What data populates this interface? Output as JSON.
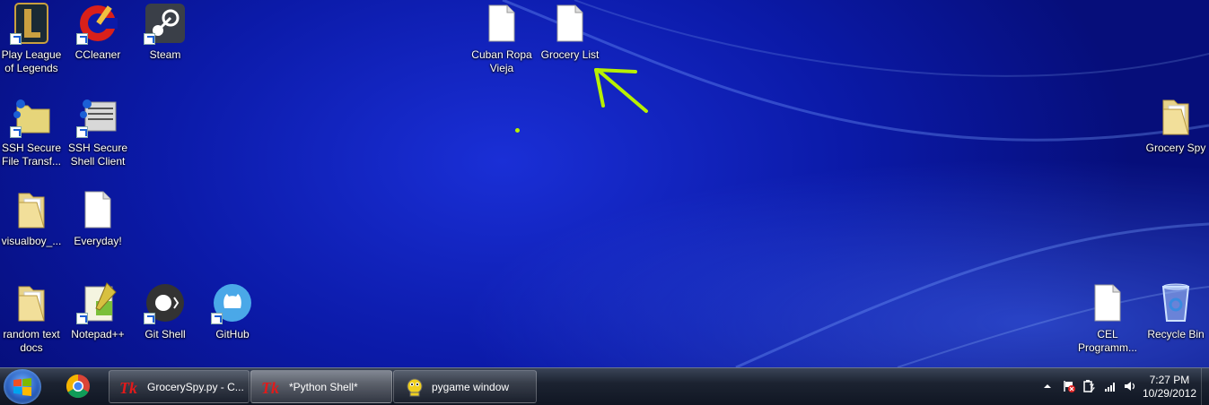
{
  "desktop": {
    "icons": [
      {
        "label": "Play League of Legends"
      },
      {
        "label": "CCleaner"
      },
      {
        "label": "Steam"
      },
      {
        "label": "SSH Secure File Transf..."
      },
      {
        "label": "SSH Secure Shell Client"
      },
      {
        "label": "visualboy_..."
      },
      {
        "label": "Everyday!"
      },
      {
        "label": "random text docs"
      },
      {
        "label": "Notepad++"
      },
      {
        "label": "Git Shell"
      },
      {
        "label": "GitHub"
      },
      {
        "label": "Cuban Ropa Vieja"
      },
      {
        "label": "Grocery List"
      },
      {
        "label": "Grocery Spy"
      },
      {
        "label": "CEL Programm..."
      },
      {
        "label": "Recycle Bin"
      }
    ],
    "annotation_color": "#b8f000"
  },
  "taskbar": {
    "tasks": [
      {
        "label": "GrocerySpy.py - C..."
      },
      {
        "label": "*Python Shell*"
      },
      {
        "label": "pygame window"
      }
    ],
    "clock": {
      "time": "7:27 PM",
      "date": "10/29/2012"
    }
  }
}
